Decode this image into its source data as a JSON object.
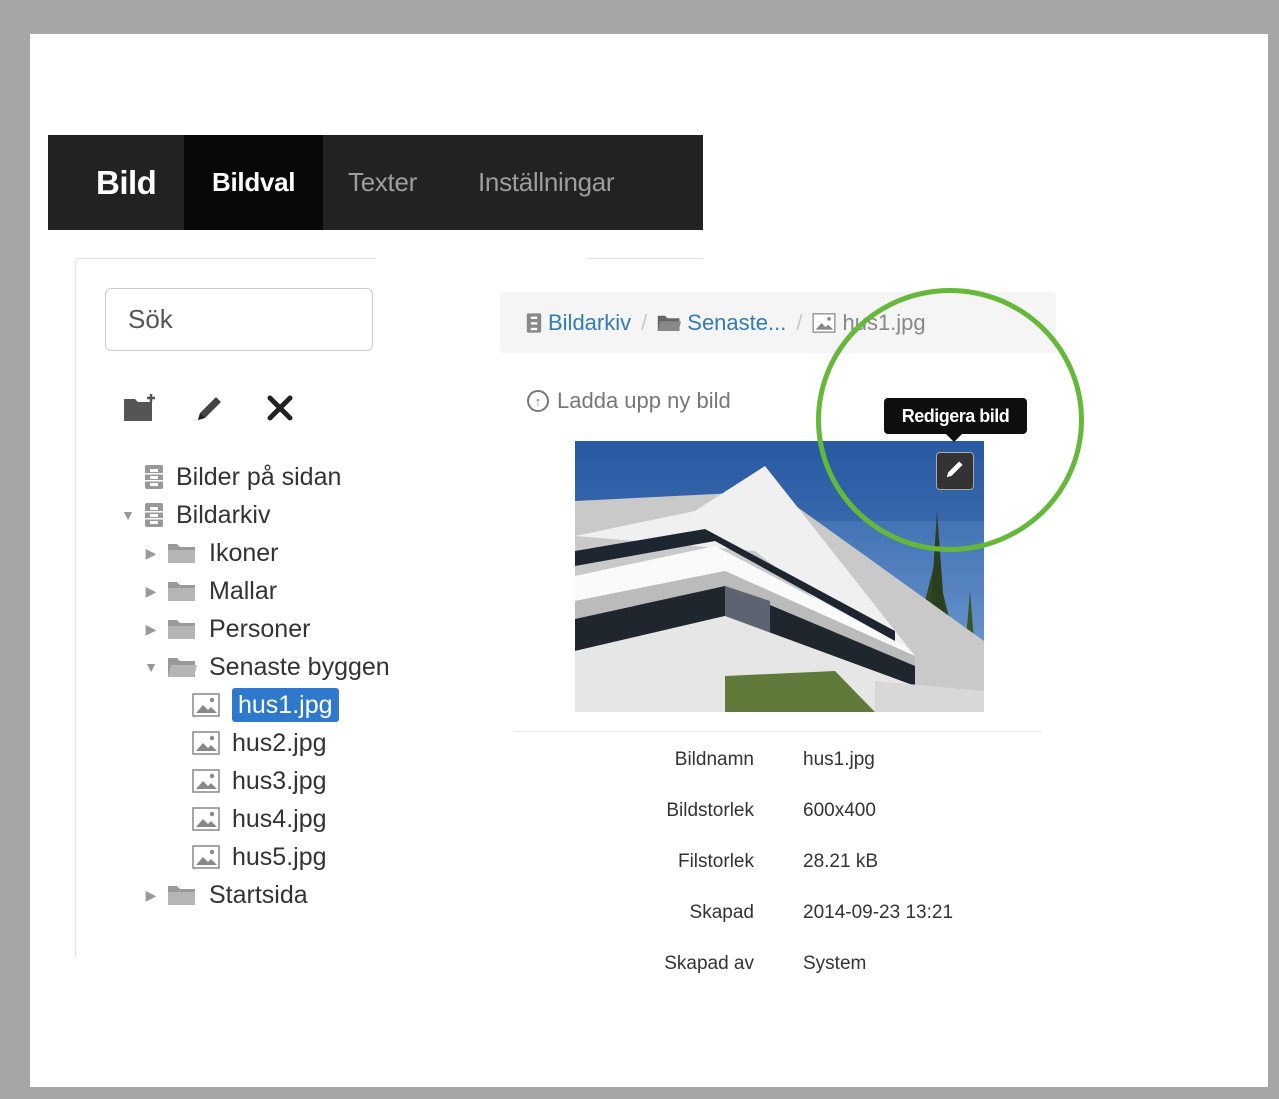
{
  "nav": {
    "brand": "Bild",
    "tabs": [
      {
        "label": "Bildval",
        "active": true
      },
      {
        "label": "Texter",
        "active": false
      },
      {
        "label": "Inställningar",
        "active": false
      }
    ]
  },
  "sidebar": {
    "search_placeholder": "Sök",
    "toolbar": [
      "new-folder-icon",
      "pencil-icon",
      "close-icon"
    ],
    "tree": [
      {
        "label": "Bilder på sidan",
        "icon": "archive-icon",
        "caret": ""
      },
      {
        "label": "Bildarkiv",
        "icon": "archive-icon",
        "caret": "▼"
      },
      {
        "label": "Ikoner",
        "icon": "folder-icon",
        "caret": "▶"
      },
      {
        "label": "Mallar",
        "icon": "folder-icon",
        "caret": "▶"
      },
      {
        "label": "Personer",
        "icon": "folder-icon",
        "caret": "▶"
      },
      {
        "label": "Senaste byggen",
        "icon": "folder-open-icon",
        "caret": "▼"
      },
      {
        "label": "hus1.jpg",
        "icon": "image-icon",
        "caret": "",
        "selected": true
      },
      {
        "label": "hus2.jpg",
        "icon": "image-icon",
        "caret": ""
      },
      {
        "label": "hus3.jpg",
        "icon": "image-icon",
        "caret": ""
      },
      {
        "label": "hus4.jpg",
        "icon": "image-icon",
        "caret": ""
      },
      {
        "label": "hus5.jpg",
        "icon": "image-icon",
        "caret": ""
      },
      {
        "label": "Startsida",
        "icon": "folder-icon",
        "caret": "▶"
      }
    ]
  },
  "breadcrumb": {
    "items": [
      "Bildarkiv",
      "Senaste...",
      "hus1.jpg"
    ],
    "separator": "/"
  },
  "upload": {
    "label": "Ladda upp ny bild"
  },
  "tooltip": {
    "text": "Redigera bild"
  },
  "details": [
    {
      "key": "Bildnamn",
      "value": "hus1.jpg"
    },
    {
      "key": "Bildstorlek",
      "value": "600x400"
    },
    {
      "key": "Filstorlek",
      "value": "28.21 kB"
    },
    {
      "key": "Skapad",
      "value": "2014-09-23 13:21"
    },
    {
      "key": "Skapad av",
      "value": "System"
    }
  ],
  "colors": {
    "navbar": "#222222",
    "nav_active": "#080808",
    "link": "#337ab7",
    "selected": "#2f79cd",
    "highlight_circle": "#66b83a"
  }
}
